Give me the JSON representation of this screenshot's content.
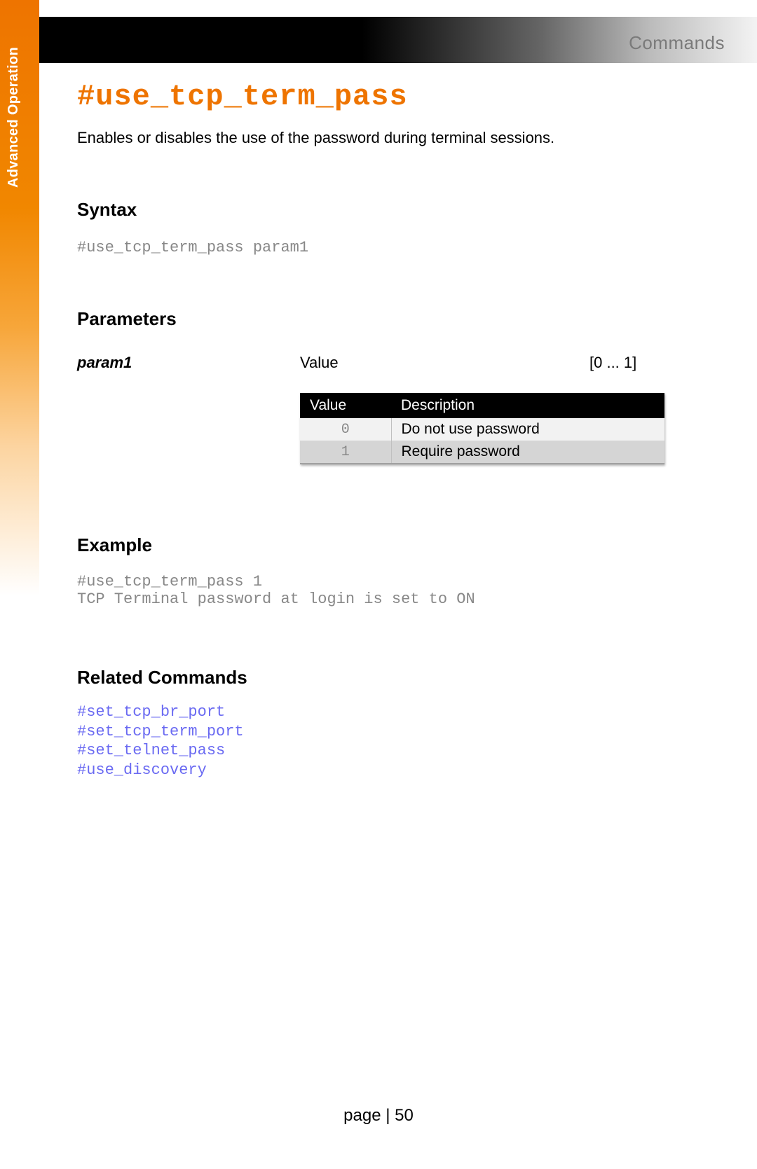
{
  "header": {
    "label": "Commands"
  },
  "sidebar": {
    "text": "Advanced Operation"
  },
  "command": {
    "title": "#use_tcp_term_pass",
    "description": "Enables or disables the use of the password during terminal sessions."
  },
  "syntax": {
    "heading": "Syntax",
    "code": "#use_tcp_term_pass param1"
  },
  "parameters": {
    "heading": "Parameters",
    "param_name": "param1",
    "param_type": "Value",
    "param_range": "[0 ... 1]",
    "table": {
      "headers": {
        "value": "Value",
        "description": "Description"
      },
      "rows": [
        {
          "value": "0",
          "description": "Do not use password"
        },
        {
          "value": "1",
          "description": "Require password"
        }
      ]
    }
  },
  "example": {
    "heading": "Example",
    "code": "#use_tcp_term_pass 1\nTCP Terminal password at login is set to ON"
  },
  "related": {
    "heading": "Related Commands",
    "links": [
      "#set_tcp_br_port",
      "#set_tcp_term_port",
      "#set_telnet_pass",
      "#use_discovery"
    ]
  },
  "footer": {
    "page_text": "page | 50"
  }
}
